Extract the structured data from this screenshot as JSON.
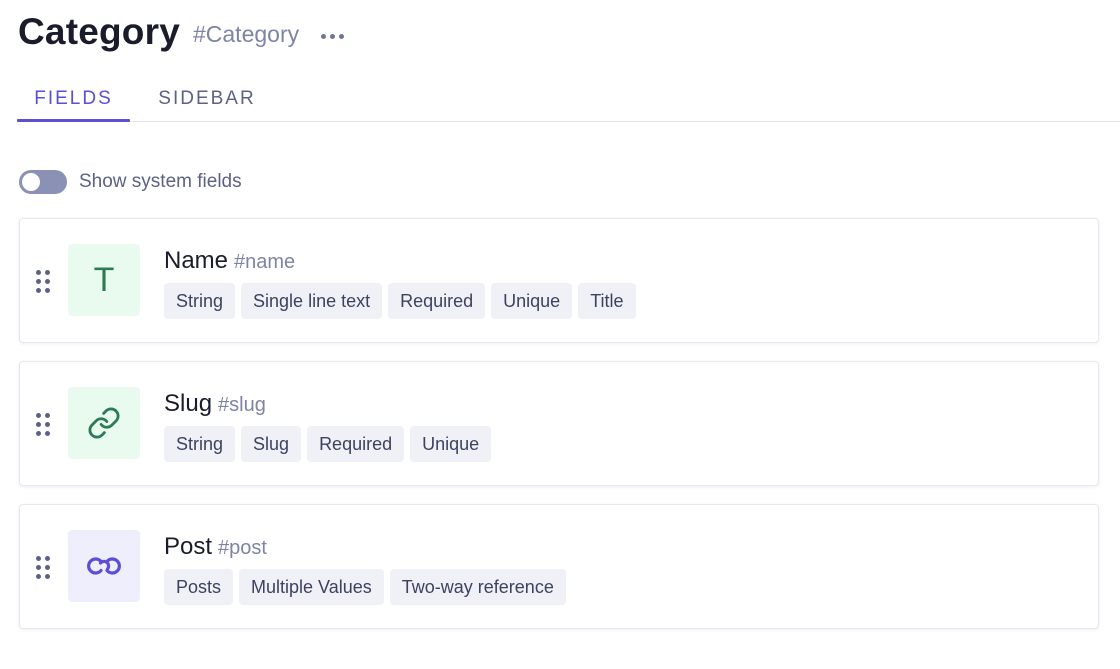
{
  "header": {
    "title": "Category",
    "api_id": "#Category",
    "more_icon": "more-horizontal-icon"
  },
  "tabs": [
    {
      "label": "FIELDS",
      "active": true
    },
    {
      "label": "SIDEBAR",
      "active": false
    }
  ],
  "system_fields": {
    "label": "Show system fields",
    "enabled": false
  },
  "colors": {
    "accent": "#5b4fd6",
    "green_icon_bg": "#e9fbee",
    "purple_icon_bg": "#eeeefc"
  },
  "fields": [
    {
      "name": "Name",
      "api_id": "#name",
      "icon": "text-t-icon",
      "icon_text": "T",
      "tags": [
        "String",
        "Single line text",
        "Required",
        "Unique",
        "Title"
      ]
    },
    {
      "name": "Slug",
      "api_id": "#slug",
      "icon": "link-icon",
      "tags": [
        "String",
        "Slug",
        "Required",
        "Unique"
      ]
    },
    {
      "name": "Post",
      "api_id": "#post",
      "icon": "reference-link-icon",
      "tags": [
        "Posts",
        "Multiple Values",
        "Two-way reference"
      ]
    }
  ]
}
